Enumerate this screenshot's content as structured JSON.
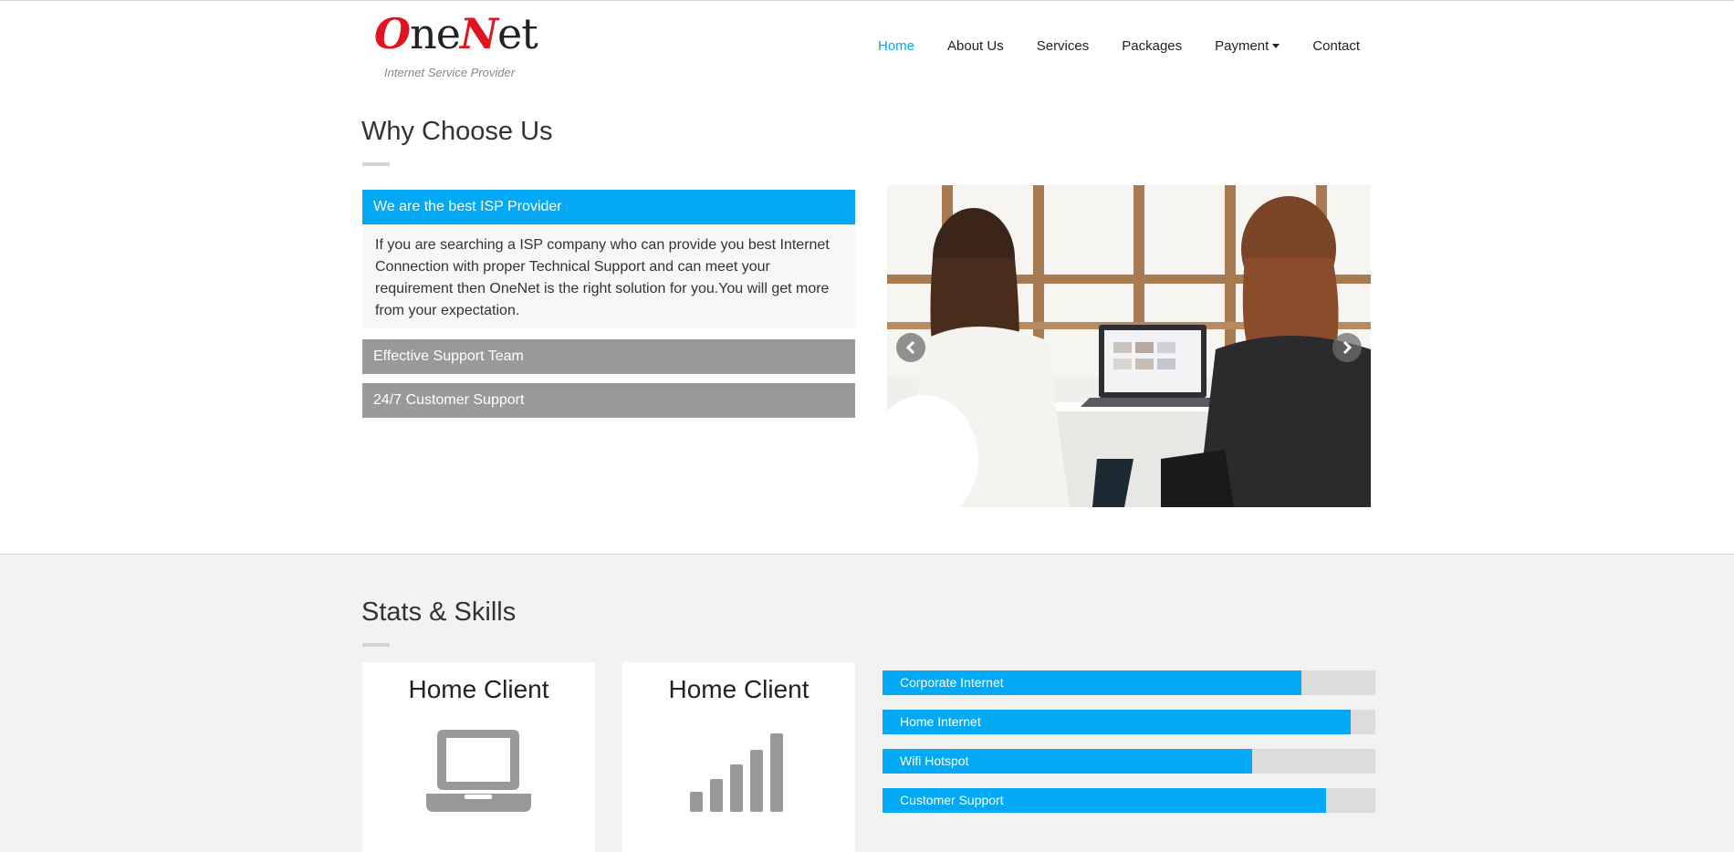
{
  "header": {
    "logo": {
      "brand": "OneNet",
      "tagline": "Internet Service Provider"
    },
    "nav": [
      {
        "label": "Home",
        "active": true
      },
      {
        "label": "About Us"
      },
      {
        "label": "Services"
      },
      {
        "label": "Packages"
      },
      {
        "label": "Payment",
        "dropdown": true
      },
      {
        "label": "Contact"
      }
    ]
  },
  "why_choose_us": {
    "title": "Why Choose Us",
    "accordion": [
      {
        "title": "We are the best ISP Provider",
        "open": true,
        "body": "If you are searching a ISP company who can provide you best Internet Connection with proper Technical Support and can meet your requirement then OneNet is the right solution for you.You will get more from your expectation."
      },
      {
        "title": "Effective Support Team",
        "open": false
      },
      {
        "title": "24/7 Customer Support",
        "open": false
      }
    ],
    "carousel": {
      "prev_icon": "chevron-left-icon",
      "next_icon": "chevron-right-icon"
    }
  },
  "stats": {
    "title": "Stats & Skills",
    "cards": [
      {
        "title": "Home Client",
        "icon": "laptop-icon"
      },
      {
        "title": "Home Client",
        "icon": "signal-bars-icon"
      }
    ],
    "skills": [
      {
        "label": "Corporate Internet",
        "percent": 85
      },
      {
        "label": "Home Internet",
        "percent": 95
      },
      {
        "label": "Wifi Hotspot",
        "percent": 75
      },
      {
        "label": "Customer Support",
        "percent": 90
      }
    ]
  },
  "colors": {
    "accent": "#03a9f4",
    "inactive": "#999999",
    "logo_red": "#e0161e",
    "track": "#dddddd"
  }
}
